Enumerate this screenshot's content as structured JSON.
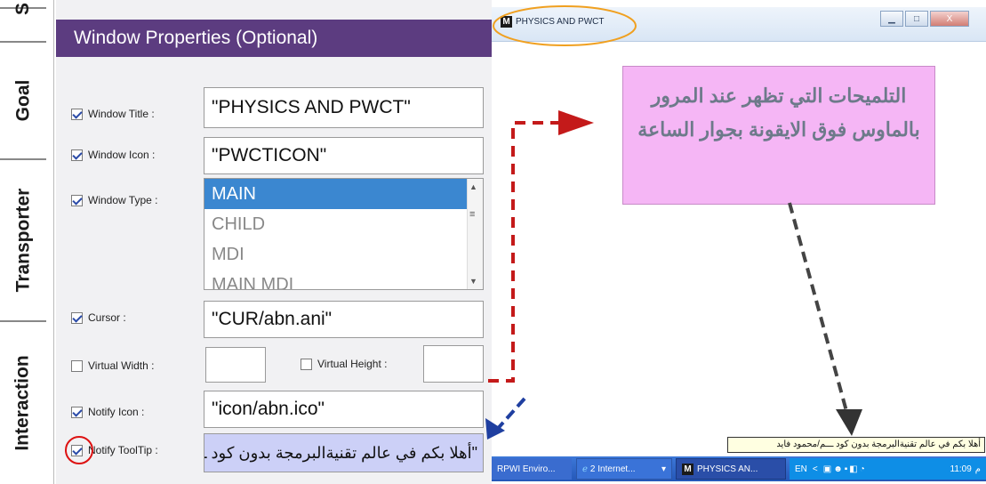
{
  "tabs": [
    "Interaction",
    "Transporter",
    "Goal",
    "S"
  ],
  "panel": {
    "title": "Window Properties (Optional)",
    "window_title": {
      "label": "Window Title :",
      "value": "\"PHYSICS AND PWCT\""
    },
    "window_icon": {
      "label": "Window Icon :",
      "value": "\"PWCTICON\""
    },
    "window_type": {
      "label": "Window Type :",
      "options": [
        "MAIN",
        "CHILD",
        "MDI",
        "MAIN MDI"
      ],
      "selected": "MAIN"
    },
    "cursor": {
      "label": "Cursor :",
      "value": "\"CUR/abn.ani\""
    },
    "virtual_width": {
      "label": "Virtual Width :",
      "value": ""
    },
    "virtual_height": {
      "label": "Virtual Height :",
      "value": ""
    },
    "notify_icon": {
      "label": "Notify Icon :",
      "value": "\"icon/abn.ico\""
    },
    "notify_tooltip": {
      "label": "Notify ToolTip :",
      "value": "\"أهلا بكم في عالم تقنيةالبرمجة بدون كود ـــم/محمود فايد\""
    }
  },
  "window": {
    "title": "PHYSICS AND PWCT",
    "icon_letter": "M",
    "callout": "التلميحات التي تظهر عند المرور بالماوس فوق الايقونة بجوار الساعة",
    "tooltip": "أهلا بكم في عالم تقنيةالبرمجة بدون كود ـــم/محمود فايد",
    "taskbar": {
      "item1": "RPWI Enviro...",
      "item2": "2 Internet...",
      "item3": "PHYSICS AN...",
      "lang": "EN",
      "clock": "11:09",
      "ampm": "م"
    }
  },
  "colors": {
    "header": "#5c3c80",
    "callout": "#f5b6f5",
    "arrow_red": "#c41a1a",
    "arrow_gray": "#444444",
    "arrow_blue": "#1f3fa0"
  }
}
